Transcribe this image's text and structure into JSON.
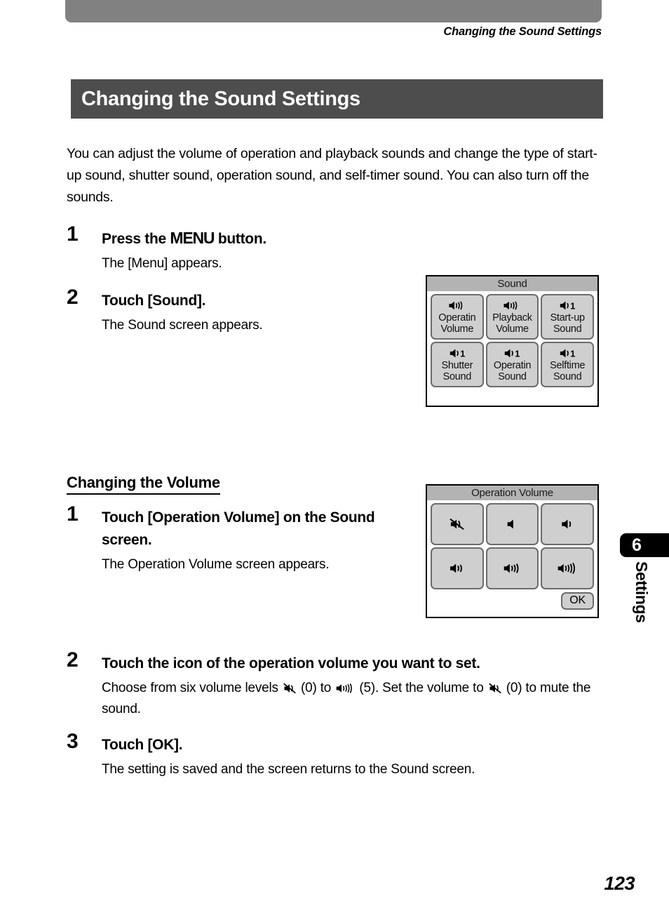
{
  "header": {
    "running_head": "Changing the Sound Settings",
    "bar_color": "#818181"
  },
  "title_bar": {
    "title": "Changing the Sound Settings",
    "background": "#4d4d4d",
    "text_color": "#ffffff"
  },
  "intro": "You can adjust the volume of operation and playback sounds and change the type of start-up sound, shutter sound, operation sound, and self-timer sound. You can also turn off the sounds.",
  "steps": [
    {
      "number": "1",
      "title_before": "Press the ",
      "title_glyph": "MENU",
      "title_after": " button.",
      "description": "The [Menu] appears."
    },
    {
      "number": "2",
      "title": "Touch [Sound].",
      "description": "The Sound screen appears."
    }
  ],
  "subsection": {
    "heading": "Changing the Volume",
    "steps": [
      {
        "number": "1",
        "title": "Touch [Operation Volume] on the Sound screen.",
        "description": "The Operation Volume screen appears."
      },
      {
        "number": "2",
        "title": "Touch the icon of the operation volume you want to set.",
        "desc_part1": "Choose from six volume levels ",
        "desc_part2": " (0) to ",
        "desc_part3": " (5). Set the volume to ",
        "desc_part4": " (0) to mute the sound."
      },
      {
        "number": "3",
        "title": "Touch [OK].",
        "description": "The setting is saved and the screen returns to the Sound screen."
      }
    ]
  },
  "sound_screen": {
    "title": "Sound",
    "buttons": [
      {
        "icon": "speaker-volume-icon",
        "line1": "Operatin",
        "line2": "Volume",
        "waves": 3
      },
      {
        "icon": "speaker-volume-icon",
        "line1": "Playback",
        "line2": "Volume",
        "waves": 3
      },
      {
        "icon": "speaker-tone-icon",
        "line1": "Start-up",
        "line2": "Sound",
        "waves": 1
      },
      {
        "icon": "speaker-tone-icon",
        "line1": "Shutter",
        "line2": "Sound",
        "waves": 1
      },
      {
        "icon": "speaker-tone-icon",
        "line1": "Operatin",
        "line2": "Sound",
        "waves": 1
      },
      {
        "icon": "speaker-tone-icon",
        "line1": "Selftime",
        "line2": "Sound",
        "waves": 1
      }
    ]
  },
  "volume_screen": {
    "title": "Operation Volume",
    "ok_label": "OK",
    "levels": [
      {
        "icon": "speaker-mute-icon",
        "level": 0,
        "waves": -1
      },
      {
        "icon": "speaker-level-1-icon",
        "level": 1,
        "waves": 0
      },
      {
        "icon": "speaker-level-2-icon",
        "level": 2,
        "waves": 1
      },
      {
        "icon": "speaker-level-3-icon",
        "level": 3,
        "waves": 2
      },
      {
        "icon": "speaker-level-4-icon",
        "level": 4,
        "waves": 3
      },
      {
        "icon": "speaker-level-5-icon",
        "level": 5,
        "waves": 4
      }
    ]
  },
  "side_tab": {
    "chapter_number": "6",
    "chapter_label": "Settings",
    "background": "#000000"
  },
  "folio": {
    "page_number": "123"
  }
}
